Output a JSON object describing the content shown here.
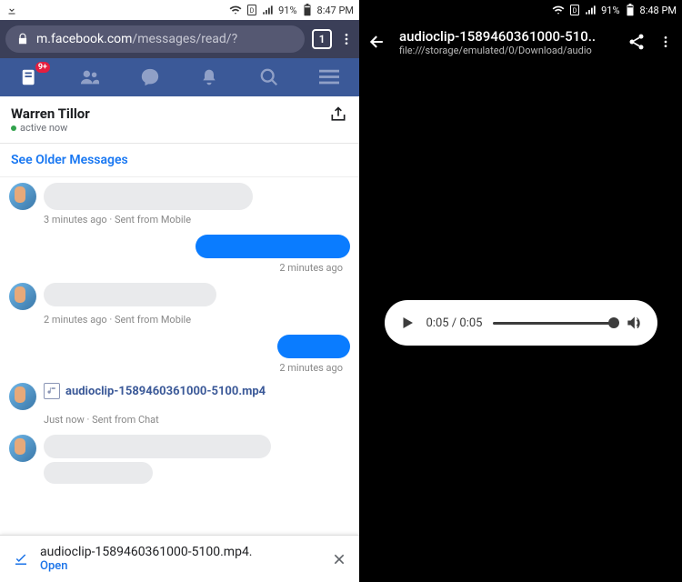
{
  "left": {
    "status": {
      "battery": "91%",
      "time": "8:47 PM"
    },
    "url": {
      "host": "m.facebook.com",
      "path": "/messages/read/?",
      "tab_count": "1"
    },
    "fbnav": {
      "badge": "9+"
    },
    "conversation": {
      "name": "Warren Tillor",
      "active": "active now",
      "older_label": "See Older Messages",
      "msgs": [
        {
          "meta": "3 minutes ago · Sent from Mobile"
        },
        {
          "meta": "2 minutes ago"
        },
        {
          "meta": "2 minutes ago · Sent from Mobile"
        },
        {
          "meta": "2 minutes ago"
        },
        {
          "file": "audioclip-1589460361000-5100.mp4",
          "meta": "Just now · Sent from Chat"
        }
      ]
    },
    "download": {
      "filename": "audioclip-1589460361000-5100.mp4.",
      "open_label": "Open"
    }
  },
  "right": {
    "status": {
      "battery": "91%",
      "time": "8:48 PM"
    },
    "header": {
      "title": "audioclip-1589460361000-510..",
      "subtitle": "file:///storage/emulated/0/Download/audio"
    },
    "player": {
      "current": "0:05",
      "total": "0:05"
    }
  }
}
